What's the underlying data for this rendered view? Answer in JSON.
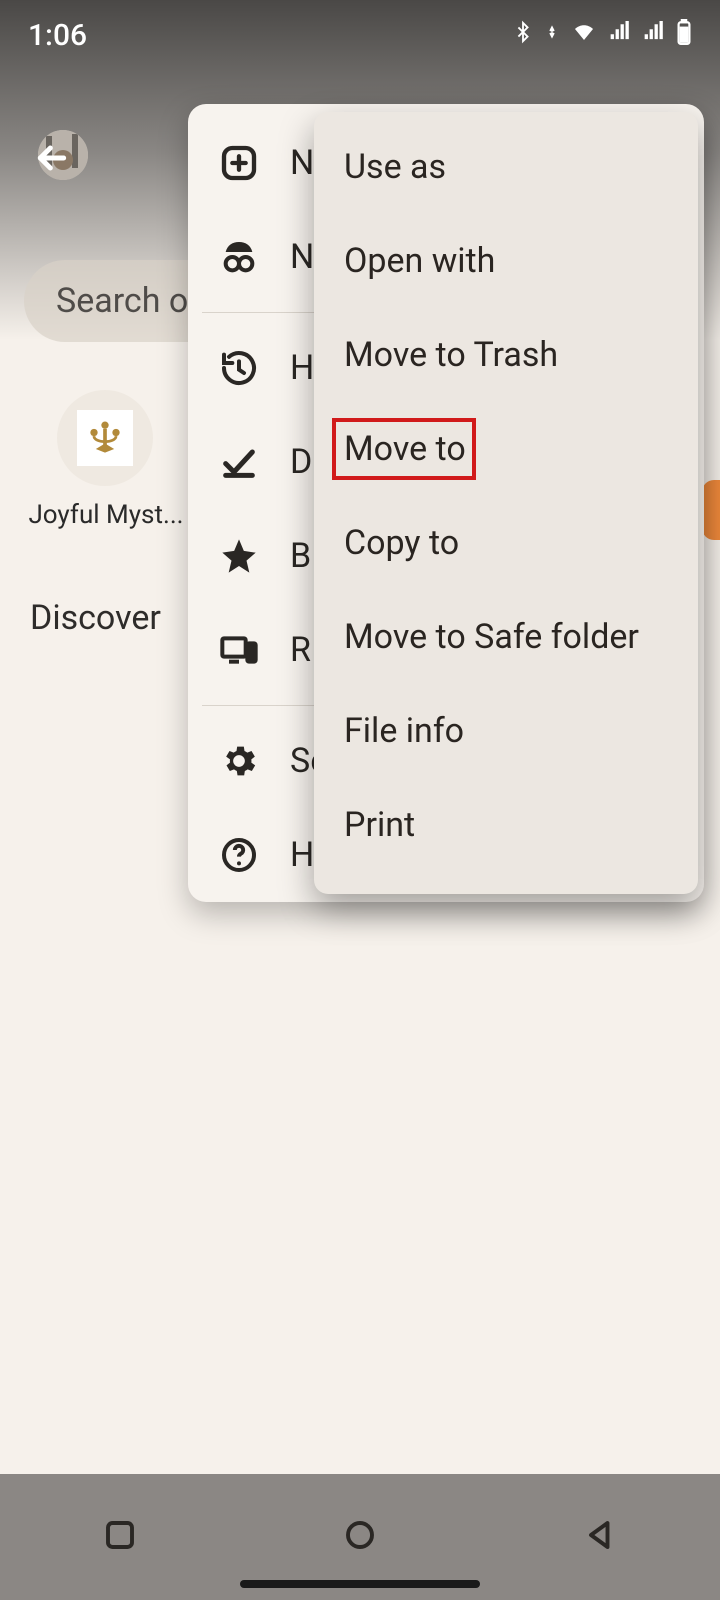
{
  "status": {
    "time": "1:06"
  },
  "search": {
    "placeholder": "Search or"
  },
  "grid": {
    "item0_label": "Joyful Myst..."
  },
  "sections": {
    "discover": "Discover"
  },
  "side_menu": {
    "items": [
      {
        "label": "N"
      },
      {
        "label": "N"
      }
    ],
    "items2": [
      {
        "label": "H"
      },
      {
        "label": "D"
      },
      {
        "label": "B"
      },
      {
        "label": "R"
      }
    ],
    "items3": [
      {
        "label": "Se"
      },
      {
        "label": "H"
      }
    ]
  },
  "menu": {
    "items": [
      "Use as",
      "Open with",
      "Move to Trash",
      "Move to",
      "Copy to",
      "Move to Safe folder",
      "File info",
      "Print"
    ],
    "highlighted_index": 3
  }
}
